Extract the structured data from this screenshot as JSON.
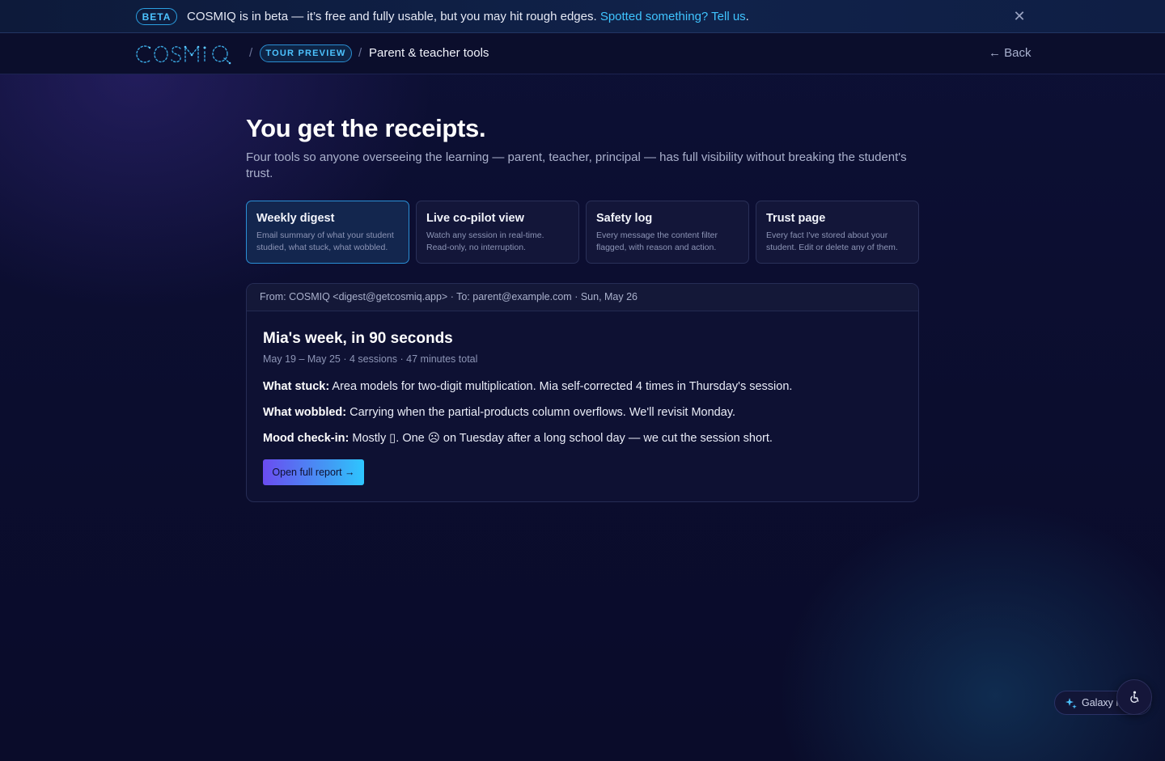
{
  "banner": {
    "badge": "BETA",
    "message": "COSMIQ is in beta — it’s free and fully usable, but you may hit rough edges. ",
    "link_text": "Spotted something? Tell us",
    "trailing": ".",
    "close_icon": "close-icon"
  },
  "nav": {
    "logo_text": "COSMIQ",
    "separator": "/",
    "tour_badge": "TOUR PREVIEW",
    "current_page": "Parent & teacher tools",
    "back_label": "← Back"
  },
  "page": {
    "title": "You get the receipts.",
    "subtitle": "Four tools so anyone overseeing the learning — parent, teacher, principal — has full visibility without breaking the student's trust."
  },
  "tools": [
    {
      "title": "Weekly digest",
      "desc": "Email summary of what your student studied, what stuck, what wobbled.",
      "active": true
    },
    {
      "title": "Live co-pilot view",
      "desc": "Watch any session in real-time. Read-only, no interruption.",
      "active": false
    },
    {
      "title": "Safety log",
      "desc": "Every message the content filter flagged, with reason and action.",
      "active": false
    },
    {
      "title": "Trust page",
      "desc": "Every fact I've stored about your student. Edit or delete any of them.",
      "active": false
    }
  ],
  "email": {
    "header": "From: COSMIQ <digest@getcosmiq.app> · To: parent@example.com · Sun, May 26",
    "subject": "Mia's week, in 90 seconds",
    "meta": "May 19 – May 25 · 4 sessions · 47 minutes total",
    "stuck_label": "What stuck:",
    "stuck_text": " Area models for two-digit multiplication. Mia self-corrected 4 times in Thursday's session.",
    "wobbled_label": "What wobbled:",
    "wobbled_text": " Carrying when the partial-products column overflows. We'll revisit Monday.",
    "mood_label": "Mood check-in:",
    "mood_text": " Mostly ▯. One ☹ on Tuesday after a long school day — we cut the session short.",
    "button_label": "Open full report →"
  },
  "widgets": {
    "galaxy_label": "Galaxy m",
    "galaxy_icon": "sparkle-icon",
    "a11y_icon": "accessibility-icon"
  }
}
